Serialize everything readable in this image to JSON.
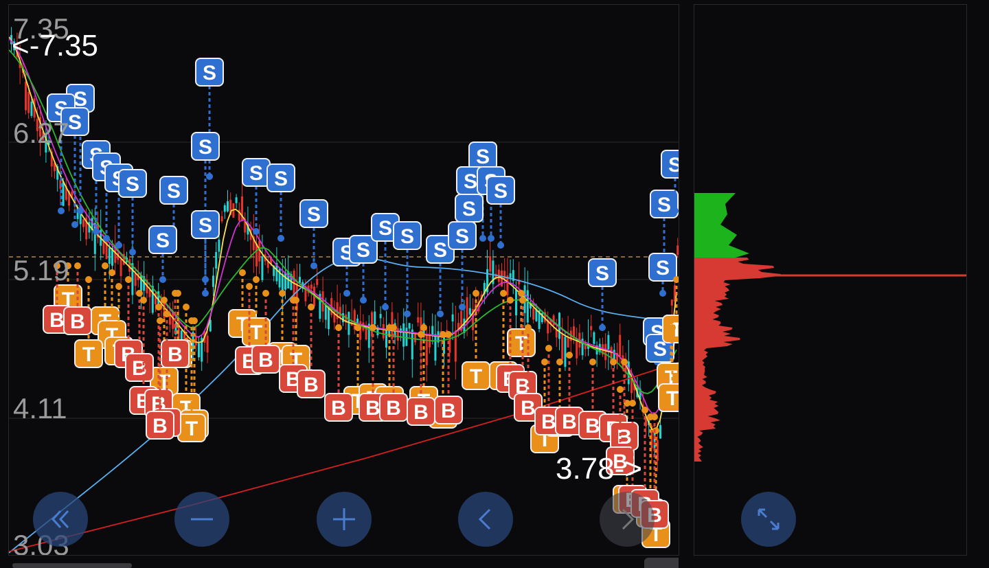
{
  "axis": {
    "price_labels": [
      "7.35",
      "6.27",
      "5.19",
      "4.11",
      "3.03"
    ],
    "high_marker": "<-7.35",
    "low_marker": "3.78->"
  },
  "signals": {
    "sell_label": "S",
    "buy_label": "B",
    "take_label": "T"
  },
  "controls": [
    {
      "name": "scroll-start-button",
      "icon": "double-chevron-left-icon"
    },
    {
      "name": "zoom-out-button",
      "icon": "minus-icon"
    },
    {
      "name": "zoom-in-button",
      "icon": "plus-icon"
    },
    {
      "name": "scroll-left-button",
      "icon": "chevron-left-icon"
    },
    {
      "name": "scroll-right-button",
      "icon": "chevron-right-icon"
    },
    {
      "name": "expand-button",
      "icon": "expand-arrows-icon"
    }
  ],
  "colors": {
    "up": "#22d3d3",
    "down": "#e8332a",
    "sell": "#2f6fcf",
    "buy": "#d8483a",
    "take": "#e8901a",
    "ma_yellow": "#ffe14a",
    "ma_magenta": "#d333d3",
    "ma_green": "#2fb82f",
    "ma_blue": "#5ab0f0",
    "ma_red": "#d42020",
    "profile_green": "#1db31d",
    "profile_red": "#d63a32"
  }
}
